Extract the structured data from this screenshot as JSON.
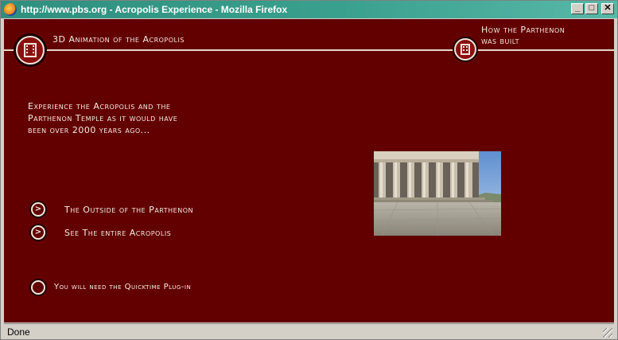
{
  "window": {
    "title": "http://www.pbs.org - Acropolis Experience - Mozilla Firefox",
    "minimize_glyph": "_",
    "maximize_glyph": "□",
    "close_glyph": "✕"
  },
  "page": {
    "header_left": "3D Animation of the Acropolis",
    "header_right_line1": "How the Parthenon",
    "header_right_line2": "was built",
    "intro_line1": "Experience the Acropolis and the",
    "intro_line2": "Parthenon Temple as it would have",
    "intro_line3": "been over 2000 years ago...",
    "links": [
      {
        "label": "The Outside of the Parthenon",
        "icon": "chevron-right-icon"
      },
      {
        "label": "See The entire Acropolis",
        "icon": "chevron-right-icon"
      }
    ],
    "plugin_note": "You will need the Quicktime Plug-in",
    "colors": {
      "background": "#620000",
      "text": "#f4ece4"
    }
  },
  "statusbar": {
    "text": "Done"
  }
}
